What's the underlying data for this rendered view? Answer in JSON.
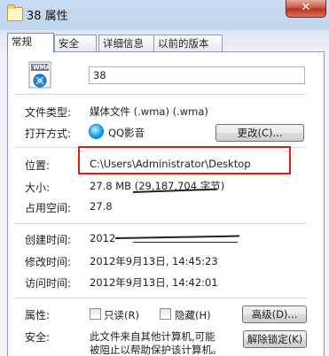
{
  "window": {
    "title": "38 属性",
    "close_glyph": "✕"
  },
  "tabs": [
    {
      "label": "常规",
      "active": true
    },
    {
      "label": "安全",
      "active": false
    },
    {
      "label": "详细信息",
      "active": false
    },
    {
      "label": "以前的版本",
      "active": false
    }
  ],
  "general": {
    "file_icon_label": "WMA",
    "name": "38",
    "type_label": "文件类型:",
    "type_value": "媒体文件 (.wma) (.wma)",
    "opens_with_label": "打开方式:",
    "opens_with_value": "QQ影音",
    "change_button": "更改(C)...",
    "location_label": "位置:",
    "location_value": "C:\\Users\\Administrator\\Desktop",
    "size_label": "大小:",
    "size_value": "27.8 MB (29,187,704 字节)",
    "size_on_disk_label": "占用空间:",
    "size_on_disk_value": "27.8",
    "created_label": "创建时间:",
    "created_value": "2012",
    "modified_label": "修改时间:",
    "modified_value": "2012年9月13日, 14:45:23",
    "accessed_label": "访问时间:",
    "accessed_value": "2012年9月13日, 14:42:01",
    "attributes_label": "属性:",
    "readonly_label": "只读(R)",
    "hidden_label": "隐藏(H)",
    "advanced_button": "高级(D)...",
    "security_label": "安全:",
    "security_text_line1": "此文件来自其他计算机,可能",
    "security_text_line2": "被阻止以帮助保护该计算机。",
    "unblock_button": "解除锁定(K)"
  },
  "colors": {
    "highlight_border": "#e01818",
    "close_button": "#c9503a"
  }
}
